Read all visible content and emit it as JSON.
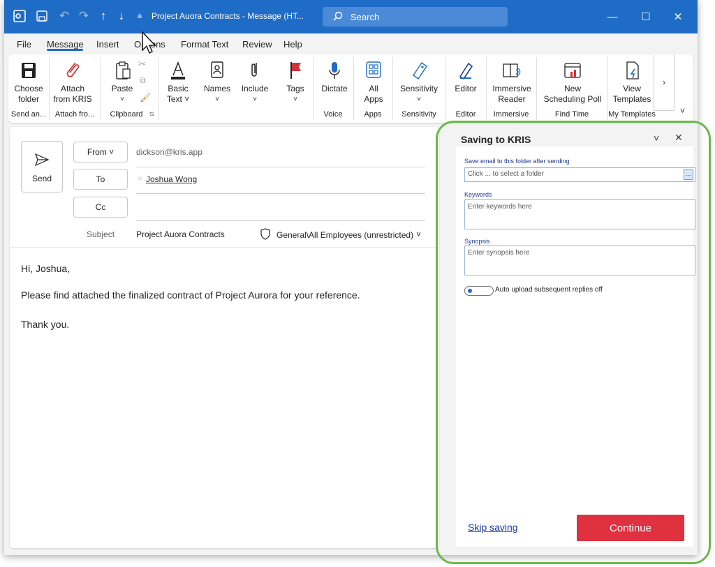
{
  "titlebar": {
    "title": "Project Auora Contracts  -  Message (HT...",
    "search_label": "Search",
    "minimize": "—",
    "maximize": "☐",
    "close": "✕"
  },
  "menu": [
    "File",
    "Message",
    "Insert",
    "Options",
    "Format Text",
    "Review",
    "Help"
  ],
  "ribbon": {
    "buttons": [
      {
        "label": "Choose\nfolder"
      },
      {
        "label": "Attach\nfrom KRIS"
      },
      {
        "label": "Paste"
      },
      {
        "label": "Basic\nText ˅"
      },
      {
        "label": "Names"
      },
      {
        "label": "Include"
      },
      {
        "label": "Tags"
      },
      {
        "label": "Dictate"
      },
      {
        "label": "All\nApps"
      },
      {
        "label": "Sensitivity"
      },
      {
        "label": "Editor"
      },
      {
        "label": "Immersive\nReader"
      },
      {
        "label": "New\nScheduling Poll"
      },
      {
        "label": "View\nTemplates"
      }
    ],
    "groups": [
      "Send an...",
      "Attach fro...",
      "Clipboard",
      "Voice",
      "Apps",
      "Sensitivity",
      "Editor",
      "Immersive",
      "Find Time",
      "My Templates"
    ]
  },
  "compose": {
    "send_label": "Send",
    "from_label": "From ˅",
    "from_value": "dickson@kris.app",
    "to_label": "To",
    "to_value": "Joshua Wong",
    "cc_label": "Cc",
    "subject_label": "Subject",
    "subject_value": "Project Auora Contracts",
    "sensitivity_value": "General\\All Employees (unrestricted)",
    "body": [
      "Hi, Joshua,",
      "Please find attached the finalized contract of Project Aurora for your reference.",
      "Thank you."
    ]
  },
  "pane": {
    "title": "Saving to KRIS",
    "folder_label": "Save email to this folder after sending",
    "folder_placeholder": "Click ... to select a folder",
    "folder_button": "...",
    "keywords_label": "Keywords",
    "keywords_placeholder": "Enter keywords here",
    "synopsis_label": "Synopsis",
    "synopsis_placeholder": "Enter synopsis here",
    "toggle_label": "Auto upload subsequent replies off",
    "skip_label": "Skip saving",
    "continue_label": "Continue"
  },
  "colors": {
    "titlebar": "#1f6cc6",
    "continue": "#e03140",
    "highlight_ring": "#6ab94a"
  }
}
